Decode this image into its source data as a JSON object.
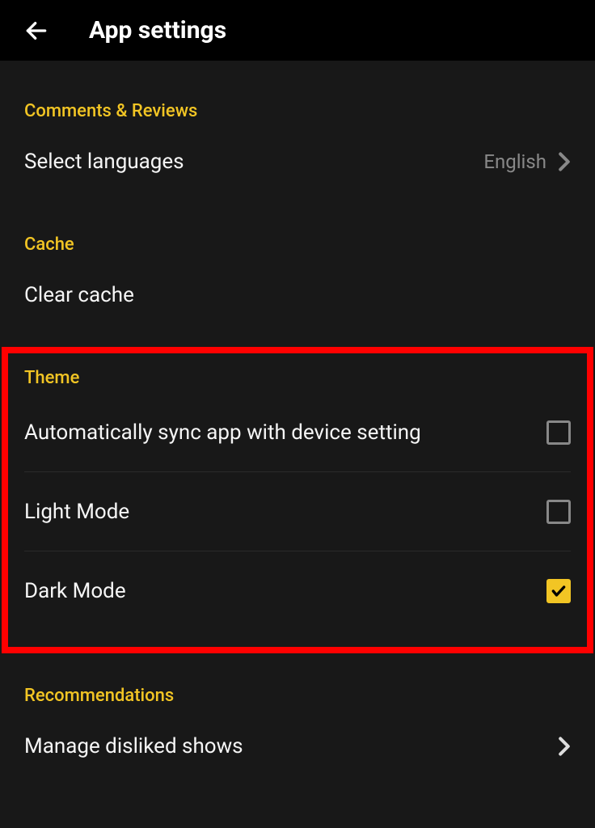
{
  "header": {
    "title": "App settings"
  },
  "sections": {
    "comments": {
      "title": "Comments & Reviews",
      "languages_label": "Select languages",
      "languages_value": "English"
    },
    "cache": {
      "title": "Cache",
      "clear_label": "Clear cache"
    },
    "theme": {
      "title": "Theme",
      "auto_label": "Automatically sync app with device setting",
      "light_label": "Light Mode",
      "dark_label": "Dark Mode",
      "auto_checked": false,
      "light_checked": false,
      "dark_checked": true
    },
    "recommendations": {
      "title": "Recommendations",
      "manage_label": "Manage disliked shows"
    }
  }
}
